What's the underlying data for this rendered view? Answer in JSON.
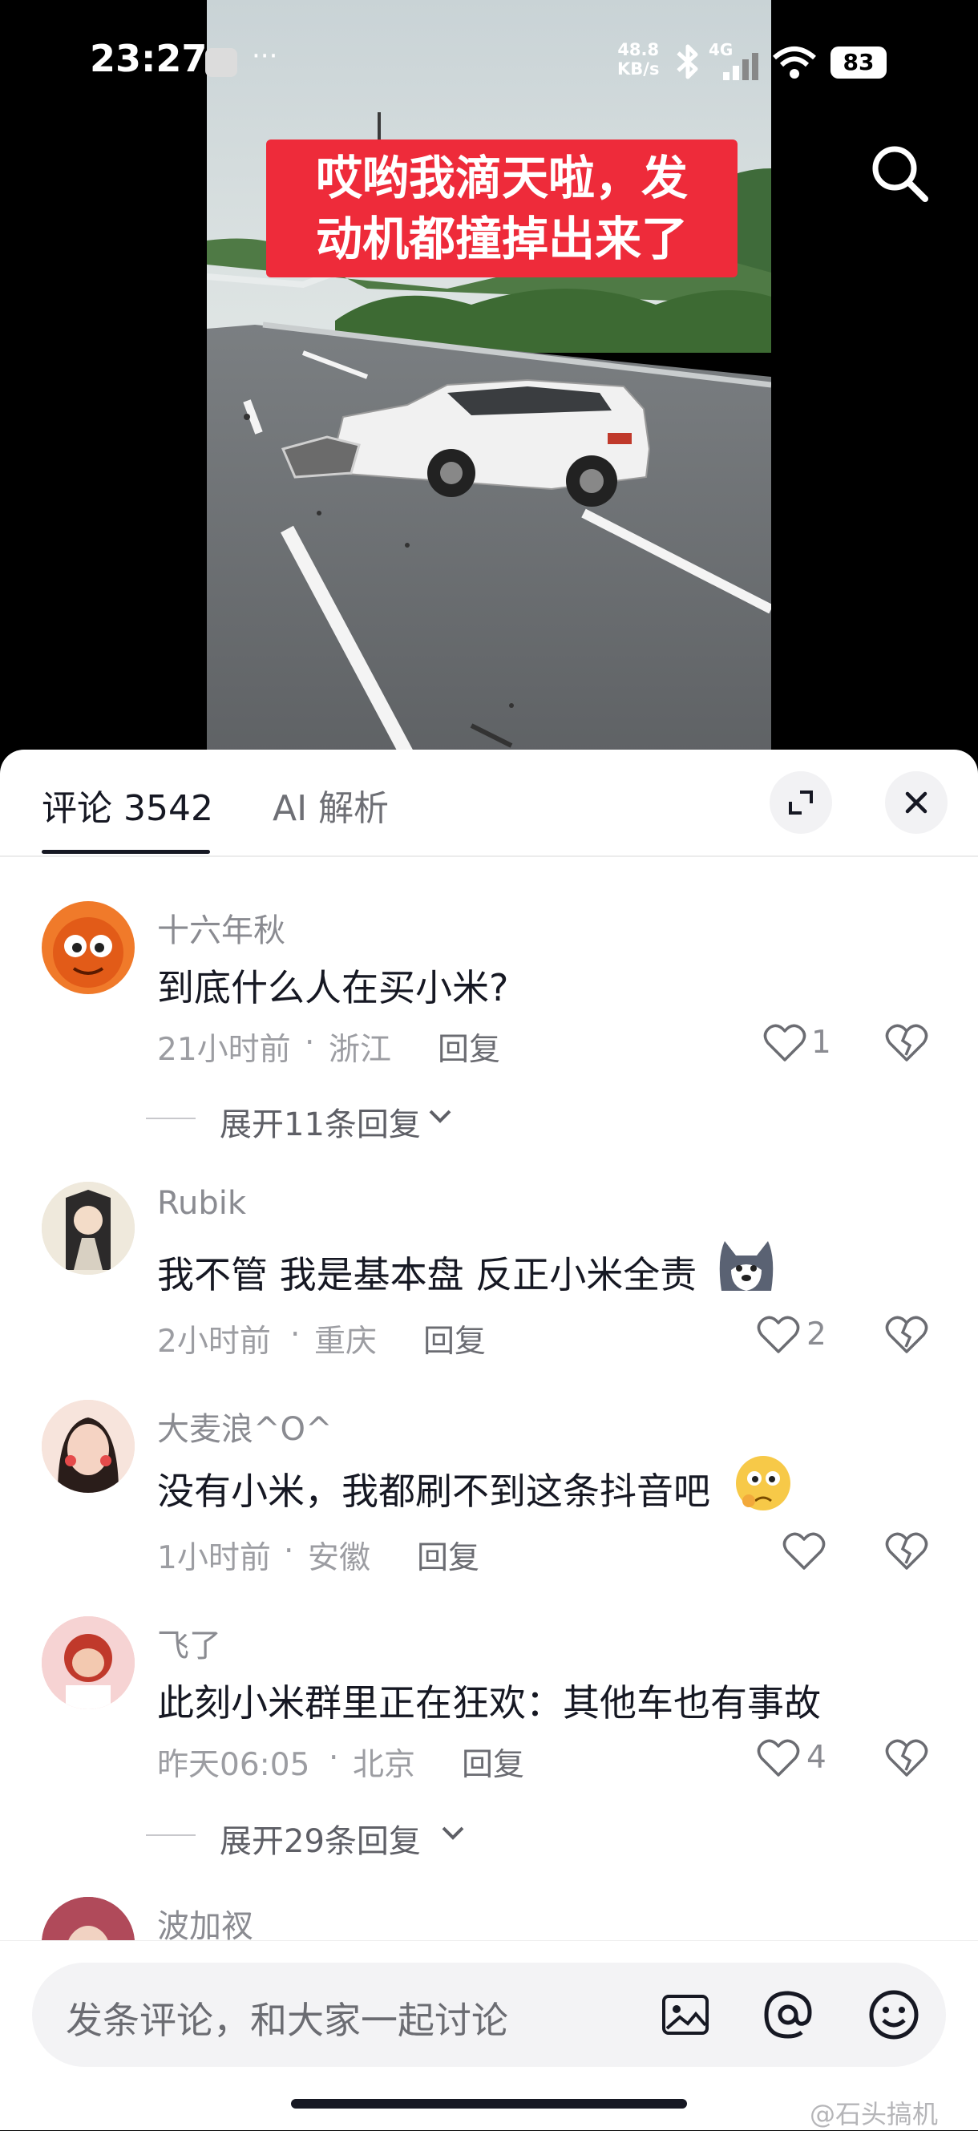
{
  "status_bar": {
    "time": "23:27",
    "dots": "···",
    "net_speed_value": "48.8",
    "net_speed_unit": "KB/s",
    "network": "4G",
    "battery": "83"
  },
  "video": {
    "caption_line1": "哎哟我滴天啦，发",
    "caption_line2": "动机都撞掉出来了"
  },
  "sheet": {
    "tabs": [
      {
        "label": "评论 3542",
        "active": true
      },
      {
        "label": "AI 解析",
        "active": false
      }
    ]
  },
  "comments": [
    {
      "user": "十六年秋",
      "text": "到底什么人在买小米?",
      "time": "21小时前",
      "location": "浙江",
      "reply": "回复",
      "likes": "1",
      "expand": "展开11条回复"
    },
    {
      "user": "Rubik",
      "text": "我不管 我是基本盘 反正小米全责",
      "time": "2小时前",
      "location": "重庆",
      "reply": "回复",
      "likes": "2"
    },
    {
      "user": "大麦浪^O^",
      "text": "没有小米，我都刷不到这条抖音吧",
      "time": "1小时前",
      "location": "安徽",
      "reply": "回复",
      "likes": ""
    },
    {
      "user": "飞了",
      "text": "此刻小米群里正在狂欢：其他车也有事故",
      "time": "昨天06:05",
      "location": "北京",
      "reply": "回复",
      "likes": "4",
      "expand": "展开29条回复"
    },
    {
      "user": "波加衩"
    }
  ],
  "meta_separator": "·",
  "input": {
    "placeholder": "发条评论，和大家一起讨论"
  },
  "watermark": "@石头搞机",
  "colors": {
    "caption_bg": "#ee2b3a",
    "text_primary": "#161823",
    "text_secondary": "#9c9da2"
  }
}
